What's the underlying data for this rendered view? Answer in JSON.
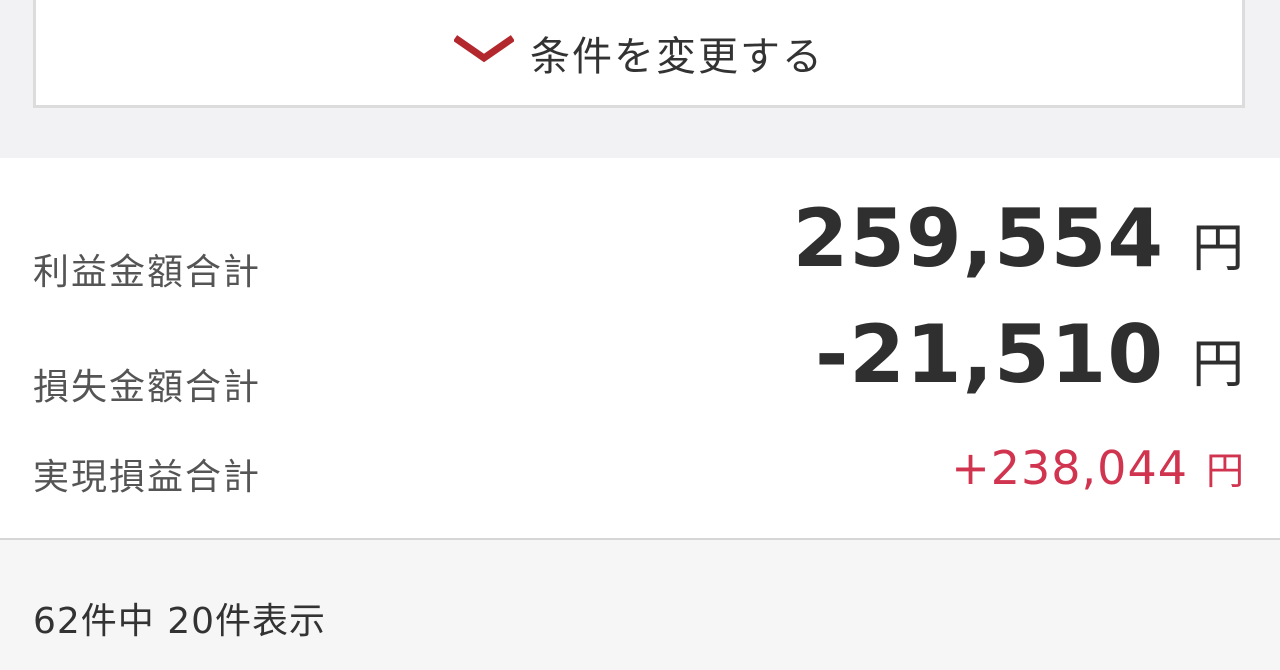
{
  "filter": {
    "change_label": "条件を変更する",
    "icon": "chevron-down-icon",
    "accent_color": "#b3282d"
  },
  "summary": {
    "profit": {
      "label": "利益金額合計",
      "value": "259,554",
      "unit": "円"
    },
    "loss": {
      "label": "損失金額合計",
      "value": "-21,510",
      "unit": "円"
    },
    "realized": {
      "label": "実現損益合計",
      "value": "+238,044",
      "unit": "円",
      "color": "#d0344f"
    }
  },
  "results": {
    "count_text": "62件中 20件表示"
  }
}
